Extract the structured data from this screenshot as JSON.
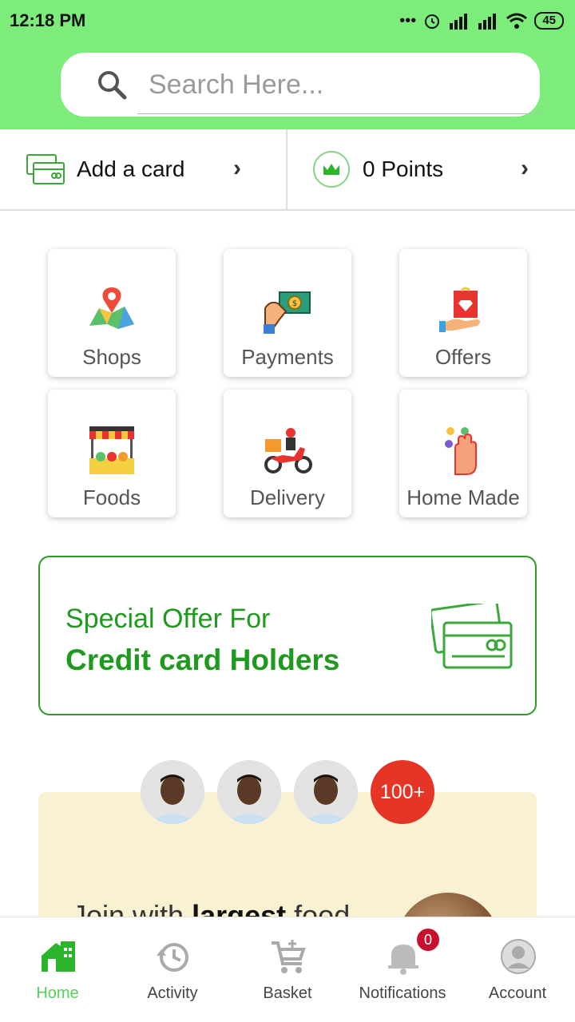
{
  "status_bar": {
    "time": "12:18 PM",
    "battery": "45"
  },
  "search": {
    "placeholder": "Search Here..."
  },
  "quick_actions": {
    "add_card": "Add a card",
    "points": "0 Points"
  },
  "tiles": [
    {
      "label": "Shops",
      "icon": "map-pin-icon"
    },
    {
      "label": "Payments",
      "icon": "cash-hand-icon"
    },
    {
      "label": "Offers",
      "icon": "gift-icon"
    },
    {
      "label": "Foods",
      "icon": "market-stall-icon"
    },
    {
      "label": "Delivery",
      "icon": "scooter-icon"
    },
    {
      "label": "Home Made",
      "icon": "hand-icon"
    }
  ],
  "offer": {
    "line1": "Special Offer For",
    "line2": "Credit card Holders"
  },
  "community": {
    "count": "100+",
    "text_prefix": "Join with",
    "text_bold": "largest",
    "text_suffix": "food"
  },
  "bottom_nav": [
    {
      "label": "Home",
      "active": true
    },
    {
      "label": "Activity"
    },
    {
      "label": "Basket"
    },
    {
      "label": "Notifications",
      "badge": "0"
    },
    {
      "label": "Account"
    }
  ],
  "colors": {
    "header": "#7cec7a",
    "accent": "#1f9a1f",
    "badge": "#e53526"
  }
}
